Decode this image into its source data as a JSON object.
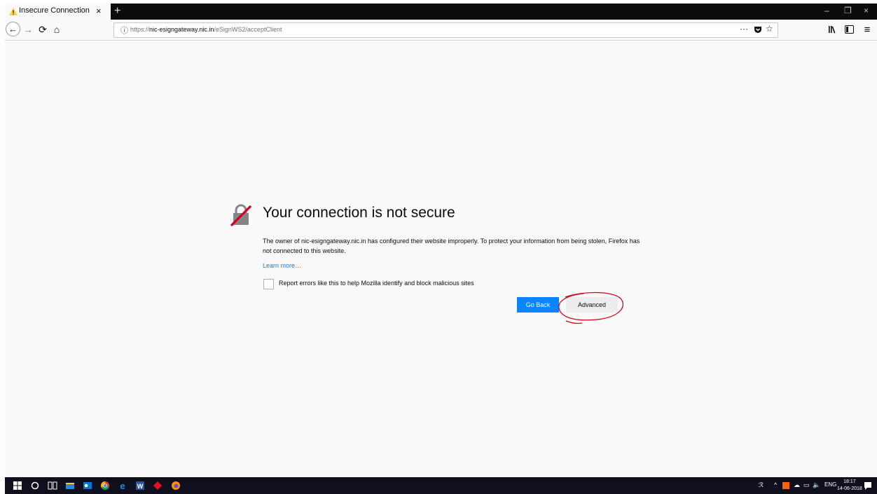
{
  "browser": {
    "tab": {
      "title": "Insecure Connection",
      "close": "×"
    },
    "new_tab": "+",
    "window_controls": {
      "minimize": "–",
      "restore": "❐",
      "close": "×"
    },
    "nav": {
      "back": "←",
      "forward": "→",
      "reload": "⟳",
      "home": "⌂"
    },
    "url": {
      "scheme": "https://",
      "host": "nic-esigngateway.nic.in",
      "path": "/eSignWS2/acceptClient"
    },
    "page_actions": {
      "more": "···",
      "pocket": "pocket-icon",
      "bookmark": "☆"
    },
    "toolbar_right": {
      "library": "library-icon",
      "sidebar": "sidebar-icon",
      "menu": "≡"
    }
  },
  "error_page": {
    "title": "Your connection is not secure",
    "description": "The owner of nic-esigngateway.nic.in has configured their website improperly. To protect your information from being stolen, Firefox has not connected to this website.",
    "learn_more": "Learn more…",
    "report_label": "Report errors like this to help Mozilla identify and block malicious sites",
    "go_back": "Go Back",
    "advanced": "Advanced"
  },
  "taskbar": {
    "icons": [
      "windows-start-icon",
      "cortana-icon",
      "task-view-icon",
      "file-explorer-icon",
      "outlook-icon",
      "chrome-icon",
      "edge-icon",
      "word-icon",
      "app-icon",
      "firefox-icon"
    ],
    "tray": {
      "lang": "ENG",
      "time": "18:17",
      "date": "14-06-2018"
    }
  },
  "colors": {
    "accent": "#0a84ff",
    "annotation": "#d0021b",
    "tabbar": "#0c0c0d",
    "taskbar": "#0f0f1e"
  }
}
